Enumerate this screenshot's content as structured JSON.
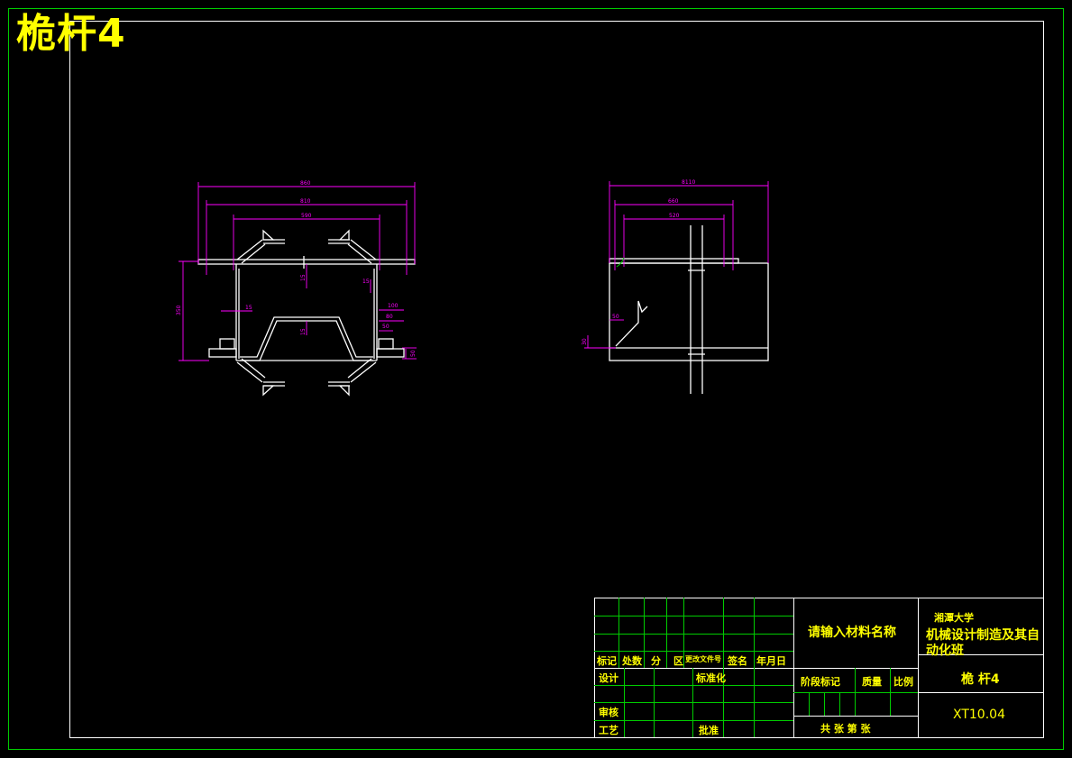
{
  "drawing_title": "桅杆4",
  "colors": {
    "frame": "#00cc00",
    "dimension": "#ff00ff",
    "geometry": "#ffffff",
    "text": "#ffff00",
    "background": "#000000"
  },
  "front_view": {
    "dims": {
      "overall_width": "860",
      "width_2": "810",
      "width_3": "590",
      "height": "350",
      "d_15a": "15",
      "d_15b": "15",
      "d_15c": "15",
      "d_15d": "15",
      "d_100": "100",
      "d_80": "80",
      "d_50a": "50",
      "d_50b": "50"
    }
  },
  "side_view": {
    "dims": {
      "overall_width": "8110",
      "width_2": "660",
      "width_3": "520",
      "d_50": "50",
      "d_30": "30"
    }
  },
  "title_block": {
    "material": "请输入材料名称",
    "school": "湘潭大学",
    "class_name": "机械设计制造及其自动化班",
    "part_name": "桅 杆4",
    "drawing_no": "XT10.04",
    "header_cells": [
      "标记",
      "处数",
      "分",
      "区",
      "更改文件号",
      "签名",
      "年月日"
    ],
    "design": "设计",
    "standardization": "标准化",
    "review": "审核",
    "process": "工艺",
    "approve": "批准",
    "stage_mark": "阶段标记",
    "weight": "质量",
    "scale": "比例",
    "sheets": "共   张  第   张"
  }
}
